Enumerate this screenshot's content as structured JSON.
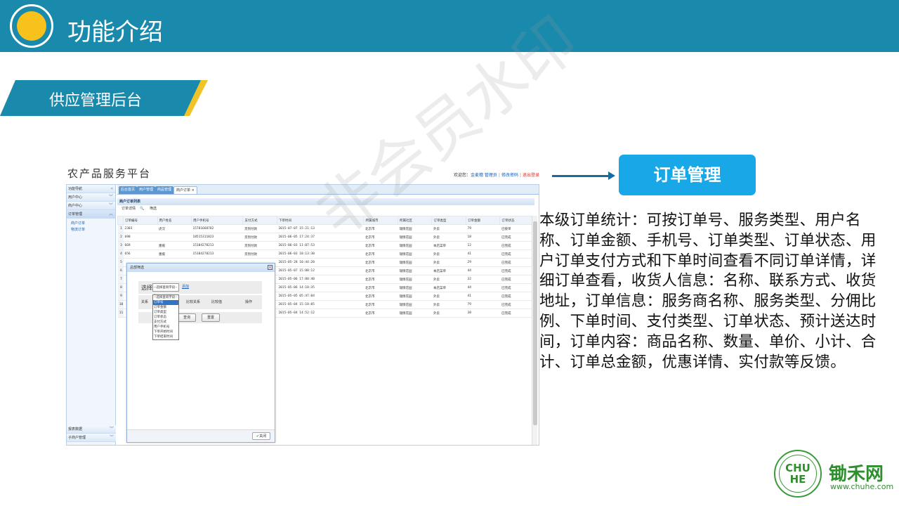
{
  "header": {
    "title": "功能介绍"
  },
  "section": {
    "title": "供应管理后台"
  },
  "watermark": "非会员水印",
  "screenshot": {
    "app_title": "农产品服务平台",
    "welcome": {
      "prefix": "欢迎您：",
      "user": "金麦穗 管理员",
      "sep": "|",
      "change_pw": "修改密码",
      "exit": "退出登录"
    },
    "sidebar": {
      "items": [
        "功能导航",
        "用户中心",
        "商户中心",
        "订单管理"
      ],
      "sub_items": [
        "商户订单",
        "物流订单"
      ],
      "bottom_items": [
        "报表数据",
        "子商户管理"
      ]
    },
    "tabs": [
      "后台首页",
      "用户管理",
      "商品管理",
      "商户订单"
    ],
    "panel_title": "商户订单列表",
    "toolbar": {
      "detail": "订单详情",
      "filter": "筛选"
    },
    "table": {
      "headers": [
        "订单编号",
        "用户姓名",
        "用户手机号",
        "支付方式",
        "下单时间",
        "所属城市",
        "所属社区",
        "订单类型",
        "订单金额",
        "订单状态"
      ],
      "rows": [
        [
          "1",
          "2303",
          "虎汉",
          "15701668782",
          "货到付款",
          "2015-07-07 15:21:13",
          "北京市",
          "瑞情花园",
          "外卖",
          "79",
          "已接单"
        ],
        [
          "2",
          "698",
          "",
          "18515311823",
          "货到付款",
          "2015-06-05 17:24:37",
          "北京市",
          "瑞情花园",
          "外卖",
          "18",
          "已完成"
        ],
        [
          "3",
          "669",
          "墨痕",
          "15104278213",
          "货到付款",
          "2015-06-03 11:07:53",
          "北京市",
          "瑞情花园",
          "本店菜单",
          "12",
          "已完成"
        ],
        [
          "4",
          "656",
          "墨痕",
          "15104278213",
          "货到付款",
          "2015-06-03 10:13:30",
          "北京市",
          "瑞情花园",
          "外卖",
          "41",
          "已完成"
        ],
        [
          "5",
          "",
          "",
          "",
          "",
          "2015-05-28 10:44:20",
          "北京市",
          "瑞情花园",
          "外卖",
          "29",
          "已完成"
        ],
        [
          "6",
          "",
          "",
          "",
          "",
          "2015-05-07 15:08:12",
          "北京市",
          "瑞情花园",
          "本店菜单",
          "44",
          "已完成"
        ],
        [
          "7",
          "",
          "",
          "",
          "",
          "2015-05-06 17:08:40",
          "北京市",
          "瑞情花园",
          "外卖",
          "32",
          "已完成"
        ],
        [
          "8",
          "",
          "",
          "",
          "",
          "2015-05-06 14:18:35",
          "北京市",
          "瑞情花园",
          "本店菜单",
          "44",
          "已完成"
        ],
        [
          "9",
          "",
          "",
          "",
          "",
          "2015-05-05 05:47:04",
          "北京市",
          "瑞情花园",
          "外卖",
          "41",
          "已完成"
        ],
        [
          "10",
          "",
          "",
          "",
          "",
          "2015-05-04 15:18:05",
          "北京市",
          "瑞情花园",
          "外卖",
          "79",
          "已完成"
        ],
        [
          "11",
          "",
          "",
          "",
          "",
          "2015-05-04 14:52:12",
          "北京市",
          "瑞情花园",
          "外卖",
          "38",
          "已完成"
        ]
      ]
    },
    "dialog": {
      "title": "总部筛选",
      "select_label": "选择",
      "select_value": "--选择查询字段--",
      "add_link": "添加",
      "row_headers": [
        "关系",
        "比较关系",
        "比较值",
        "操作"
      ],
      "query_btn": "查询",
      "reset_btn": "重置",
      "options": [
        "--选择查询字段--",
        "订单号",
        "订单金额",
        "订单类型",
        "订单状态",
        "支付方式",
        "用户手机号",
        "下单开始时间",
        "下单结束时间"
      ],
      "selected_option_index": 1,
      "close_btn": "关闭"
    }
  },
  "callout": {
    "label": "订单管理"
  },
  "description": "本级订单统计：可按订单号、服务类型、用户名称、订单金额、手机号、订单类型、订单状态、用户订单支付方式和下单时间查看不同订单详情，详细订单查看，收货人信息：名称、联系方式、收货地址，订单信息：服务商名称、服务类型、分佣比例、下单时间、支付类型、订单状态、预计送达时间，订单内容：商品名称、数量、单价、小计、合计、订单总金额，优惠详情、实付款等反馈。",
  "brand": {
    "seal_mark": "CHU HE",
    "name": "锄禾网",
    "url": "www.chuhe.com"
  },
  "colors": {
    "band": "#1a8aac",
    "accent_yellow": "#f2c327",
    "callout": "#18a8e8",
    "brand_green": "#2f8f2f"
  }
}
